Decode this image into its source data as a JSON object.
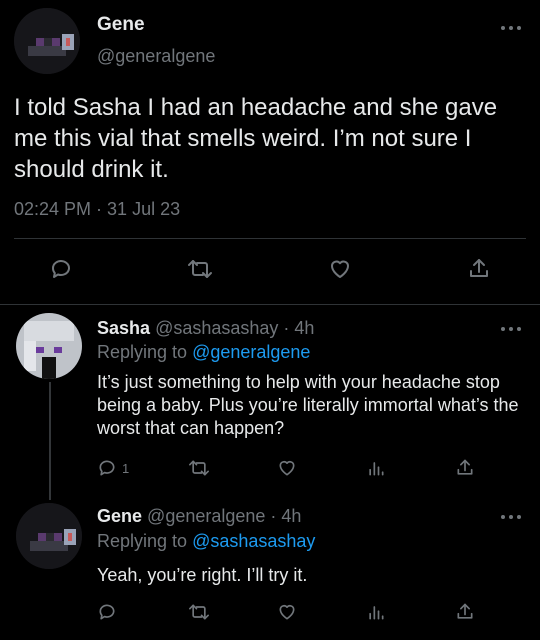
{
  "main_tweet": {
    "display_name": "Gene",
    "handle": "@generalgene",
    "text": "I told Sasha I had an headache and she gave me this vial that smells weird. I’m not sure I should drink it.",
    "timestamp": "02:24 PM · 31 Jul 23"
  },
  "replies": [
    {
      "display_name": "Sasha",
      "handle_time": "@sashasashay · 4h",
      "replying_prefix": "Replying to ",
      "replying_to": "@generalgene",
      "text": "It’s just something to help with your headache stop being a baby. Plus you’re literally immortal what’s the worst that can happen?",
      "reply_count": "1"
    },
    {
      "display_name": "Gene",
      "handle_time": "@generalgene · 4h",
      "replying_prefix": "Replying to ",
      "replying_to": "@sashasashay",
      "text": "Yeah, you’re right. I’ll try it."
    }
  ],
  "colors": {
    "background": "#000000",
    "text": "#e7e9ea",
    "muted": "#71767b",
    "link": "#1d9bf0",
    "divider": "#2f3336"
  },
  "icons": [
    "more-icon",
    "reply-icon",
    "retweet-icon",
    "like-icon",
    "share-icon",
    "views-icon"
  ]
}
